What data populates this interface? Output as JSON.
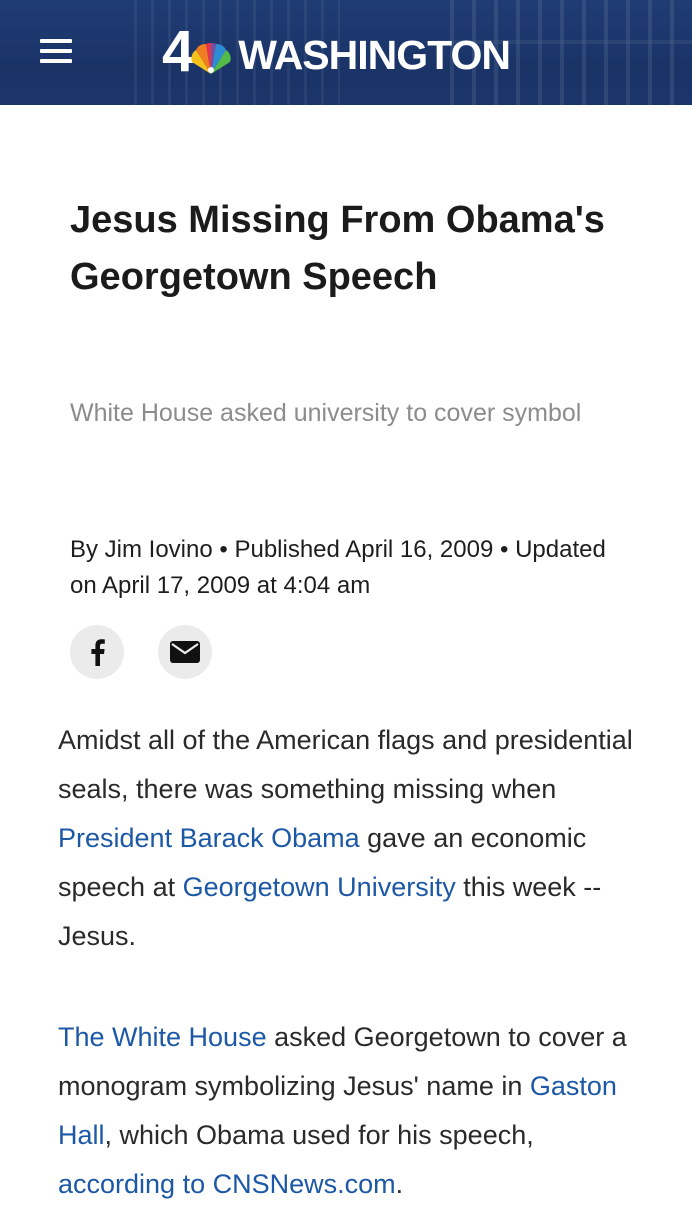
{
  "header": {
    "logo_number": "4",
    "logo_word": "WASHINGTON",
    "brand_color": "#1f3c74"
  },
  "article": {
    "title": "Jesus Missing From Obama's Georgetown Speech",
    "subtitle": "White House asked university to cover symbol",
    "byline": {
      "by": "By Jim Iovino",
      "separator": " • ",
      "published": "Published April 16, 2009",
      "updated": "Updated on April 17, 2009 at 4:04 am"
    },
    "share": {
      "facebook_icon": "facebook-icon",
      "email_icon": "email-icon"
    },
    "paragraph1": {
      "t1": "Amidst all of the American flags and presidential seals, there was something missing when ",
      "link1": "President Barack Obama",
      "t2": " gave an economic speech at ",
      "link2": "Georgetown University",
      "t3": " this week -- Jesus."
    },
    "paragraph2": {
      "link1": "The White House",
      "t1": " asked Georgetown to cover a monogram symbolizing Jesus' name in ",
      "link2": "Gaston Hall",
      "t2": ", which Obama used for his speech, ",
      "link3": "according to CNSNews.com",
      "t3": "."
    },
    "link_color": "#1c58a6"
  }
}
